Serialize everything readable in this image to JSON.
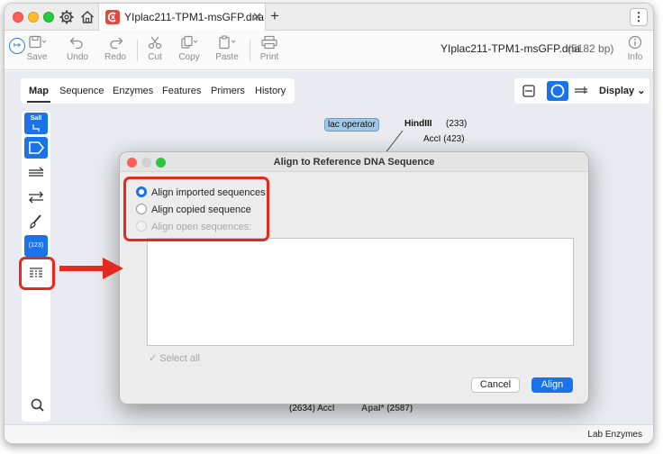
{
  "tab": {
    "title": "YIplac211-TPM1-msGFP.dna",
    "close": "✕",
    "new_tab": "+"
  },
  "toolbar": {
    "save": "Save",
    "undo": "Undo",
    "redo": "Redo",
    "cut": "Cut",
    "copy": "Copy",
    "paste": "Paste",
    "print": "Print",
    "info": "Info"
  },
  "document": {
    "file_name": "YIplac211-TPM1-msGFP.dna",
    "bp": "(5182 bp)"
  },
  "view_tabs": [
    "Map",
    "Sequence",
    "Enzymes",
    "Features",
    "Primers",
    "History"
  ],
  "display_label": "Display",
  "left_tools": {
    "sall": "SalI",
    "numbers": "(123)"
  },
  "map": {
    "lac_operator": "lac operator",
    "hindiii": "HindIII",
    "hindiii_pos": "(233)",
    "acci_top": "AccI  (423)",
    "bottom_left": "(2634)  AccI",
    "bottom_right": "ApaI*  (2587)"
  },
  "footer": {
    "enzyme_set": "Lab Enzymes"
  },
  "dialog": {
    "title": "Align to Reference DNA Sequence",
    "option_imported": "Align imported sequences",
    "option_copied": "Align copied sequence",
    "option_open": "Align open sequences:",
    "select_all": "Select all",
    "cancel": "Cancel",
    "align": "Align",
    "selected_option": "imported"
  },
  "colors": {
    "accent": "#1a73e8",
    "annotation": "#e22a1f"
  }
}
